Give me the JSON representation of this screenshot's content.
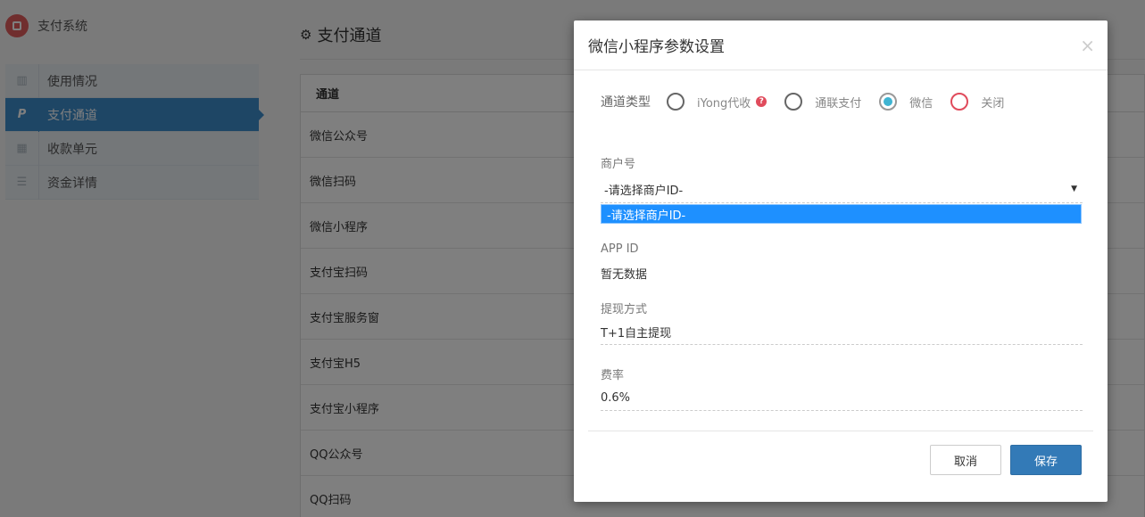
{
  "app": {
    "brand_title": "支付系统",
    "page_title": "支付通道",
    "sidebar": [
      {
        "label": "使用情况",
        "icon": "bar-chart-icon",
        "active": false
      },
      {
        "label": "支付通道",
        "icon": "paypal-icon",
        "active": true
      },
      {
        "label": "收款单元",
        "icon": "grid-icon",
        "active": false
      },
      {
        "label": "资金详情",
        "icon": "list-icon",
        "active": false
      }
    ],
    "table": {
      "header": "通道",
      "rows": [
        "微信公众号",
        "微信扫码",
        "微信小程序",
        "支付宝扫码",
        "支付宝服务窗",
        "支付宝H5",
        "支付宝小程序",
        "QQ公众号",
        "QQ扫码"
      ]
    }
  },
  "modal": {
    "title": "微信小程序参数设置",
    "close_symbol": "×",
    "channel_type": {
      "label": "通道类型",
      "options": [
        {
          "label": "iYong代收",
          "checked": false,
          "has_help": true
        },
        {
          "label": "通联支付",
          "checked": false
        },
        {
          "label": "微信",
          "checked": true
        },
        {
          "label": "关闭",
          "checked": false,
          "color": "#e04b5c"
        }
      ],
      "help_symbol": "?"
    },
    "merchant": {
      "label": "商户号",
      "selected": "-请选择商户ID-",
      "dropdown_option": "-请选择商户ID-",
      "arrow": "▼"
    },
    "app_id": {
      "label": "APP ID",
      "value": "暂无数据"
    },
    "withdraw": {
      "label": "提现方式",
      "value": "T+1自主提现"
    },
    "rate": {
      "label": "费率",
      "value": "0.6%"
    },
    "buttons": {
      "cancel": "取消",
      "save": "保存"
    }
  },
  "colors": {
    "accent": "#3d8ccb",
    "save_button": "#337ab7",
    "selected_option": "#1e90ff",
    "radio_checked": "#3fb4d2",
    "danger": "#e04b5c"
  }
}
